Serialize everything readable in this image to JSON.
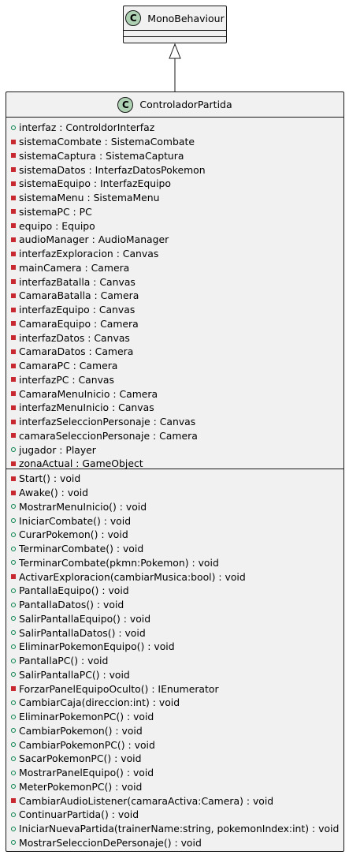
{
  "diagram": {
    "parent_class": {
      "icon": "C",
      "name": "MonoBehaviour"
    },
    "main_class": {
      "icon": "C",
      "name": "ControladorPartida",
      "attributes": [
        {
          "visibility": "public",
          "text": "interfaz : ControldorInterfaz"
        },
        {
          "visibility": "private",
          "text": "sistemaCombate : SistemaCombate"
        },
        {
          "visibility": "private",
          "text": "sistemaCaptura : SistemaCaptura"
        },
        {
          "visibility": "private",
          "text": "sistemaDatos : InterfazDatosPokemon"
        },
        {
          "visibility": "private",
          "text": "sistemaEquipo : InterfazEquipo"
        },
        {
          "visibility": "private",
          "text": "sistemaMenu : SistemaMenu"
        },
        {
          "visibility": "private",
          "text": "sistemaPC : PC"
        },
        {
          "visibility": "private",
          "text": "equipo : Equipo"
        },
        {
          "visibility": "private",
          "text": "audioManager : AudioManager"
        },
        {
          "visibility": "private",
          "text": "interfazExploracion : Canvas"
        },
        {
          "visibility": "private",
          "text": "mainCamera : Camera"
        },
        {
          "visibility": "private",
          "text": "interfazBatalla : Canvas"
        },
        {
          "visibility": "private",
          "text": "CamaraBatalla : Camera"
        },
        {
          "visibility": "private",
          "text": "interfazEquipo : Canvas"
        },
        {
          "visibility": "private",
          "text": "CamaraEquipo : Camera"
        },
        {
          "visibility": "private",
          "text": "interfazDatos : Canvas"
        },
        {
          "visibility": "private",
          "text": "CamaraDatos : Camera"
        },
        {
          "visibility": "private",
          "text": "CamaraPC : Camera"
        },
        {
          "visibility": "private",
          "text": "interfazPC : Canvas"
        },
        {
          "visibility": "private",
          "text": "CamaraMenuInicio : Camera"
        },
        {
          "visibility": "private",
          "text": "interfazMenuInicio : Canvas"
        },
        {
          "visibility": "private",
          "text": "interfazSeleccionPersonaje : Canvas"
        },
        {
          "visibility": "private",
          "text": "camaraSeleccionPersonaje : Camera"
        },
        {
          "visibility": "public",
          "text": "jugador : Player"
        },
        {
          "visibility": "private",
          "text": "zonaActual : GameObject"
        }
      ],
      "methods": [
        {
          "visibility": "private",
          "text": "Start() : void"
        },
        {
          "visibility": "private",
          "text": "Awake() : void"
        },
        {
          "visibility": "public",
          "text": "MostrarMenuInicio() : void"
        },
        {
          "visibility": "public",
          "text": "IniciarCombate() : void"
        },
        {
          "visibility": "public",
          "text": "CurarPokemon() : void"
        },
        {
          "visibility": "public",
          "text": "TerminarCombate() : void"
        },
        {
          "visibility": "public",
          "text": "TerminarCombate(pkmn:Pokemon) : void"
        },
        {
          "visibility": "private",
          "text": "ActivarExploracion(cambiarMusica:bool) : void"
        },
        {
          "visibility": "public",
          "text": "PantallaEquipo() : void"
        },
        {
          "visibility": "public",
          "text": "PantallaDatos() : void"
        },
        {
          "visibility": "public",
          "text": "SalirPantallaEquipo() : void"
        },
        {
          "visibility": "public",
          "text": "SalirPantallaDatos() : void"
        },
        {
          "visibility": "public",
          "text": "EliminarPokemonEquipo() : void"
        },
        {
          "visibility": "public",
          "text": "PantallaPC() : void"
        },
        {
          "visibility": "public",
          "text": "SalirPantallaPC() : void"
        },
        {
          "visibility": "private",
          "text": "ForzarPanelEquipoOculto() : IEnumerator"
        },
        {
          "visibility": "public",
          "text": "CambiarCaja(direccion:int) : void"
        },
        {
          "visibility": "public",
          "text": "EliminarPokemonPC() : void"
        },
        {
          "visibility": "public",
          "text": "CambiarPokemon() : void"
        },
        {
          "visibility": "public",
          "text": "CambiarPokemonPC() : void"
        },
        {
          "visibility": "public",
          "text": "SacarPokemonPC() : void"
        },
        {
          "visibility": "public",
          "text": "MostrarPanelEquipo() : void"
        },
        {
          "visibility": "public",
          "text": "MeterPokemonPC() : void"
        },
        {
          "visibility": "private",
          "text": "CambiarAudioListener(camaraActiva:Camera) : void"
        },
        {
          "visibility": "public",
          "text": "ContinuarPartida() : void"
        },
        {
          "visibility": "public",
          "text": "IniciarNuevaPartida(trainerName:string, pokemonIndex:int) : void"
        },
        {
          "visibility": "public",
          "text": "MostrarSeleccionDePersonaje() : void"
        }
      ]
    },
    "relation": {
      "type": "generalization",
      "from": "ControladorPartida",
      "to": "MonoBehaviour"
    },
    "colors": {
      "class_fill": "#f1f1f1",
      "border": "#181818",
      "class_icon_fill": "#add1b2",
      "public_marker": "#038048",
      "private_marker": "#c82930"
    }
  }
}
